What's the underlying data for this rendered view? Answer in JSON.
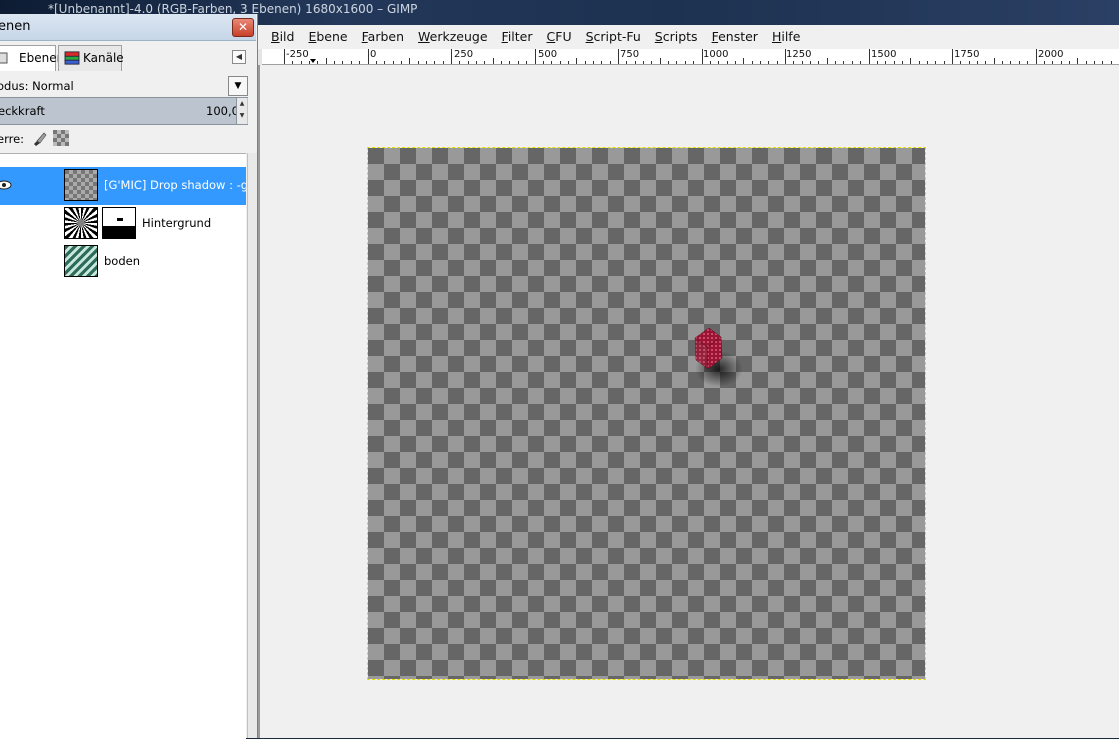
{
  "window": {
    "title": "*[Unbenannt]-4.0 (RGB-Farben, 3 Ebenen) 1680x1600 – GIMP"
  },
  "menubar": {
    "items": [
      "Bild",
      "Ebene",
      "Farben",
      "Werkzeuge",
      "Filter",
      "CFU",
      "Script-Fu",
      "Scripts",
      "Fenster",
      "Hilfe"
    ]
  },
  "ruler": {
    "labels": [
      "-250",
      "0",
      "250",
      "500",
      "750",
      "1000",
      "1250",
      "1500",
      "1750",
      "2000"
    ]
  },
  "layers_dock": {
    "title": "enen",
    "close_label": "✕",
    "tabs": [
      "Ebenen",
      "Kanäle"
    ],
    "mode_label": "odus: Normal",
    "opacity_label": "eckkraft",
    "opacity_value": "100,0",
    "lock_label": "erre:",
    "layers": [
      {
        "name": "[G'MIC] Drop shadow : -gim",
        "selected": true
      },
      {
        "name": "Hintergrund",
        "selected": false
      },
      {
        "name": "boden",
        "selected": false
      }
    ]
  },
  "colors": {
    "selection": "#3399ff",
    "canvas_border": "#e8e000",
    "cube": "#9a1533"
  },
  "icons": [
    "close-icon",
    "layers-tab-icon",
    "channels-tab-icon",
    "dock-menu-icon",
    "dropdown-arrow-icon",
    "paint-lock-icon",
    "alpha-lock-icon",
    "eye-icon"
  ]
}
